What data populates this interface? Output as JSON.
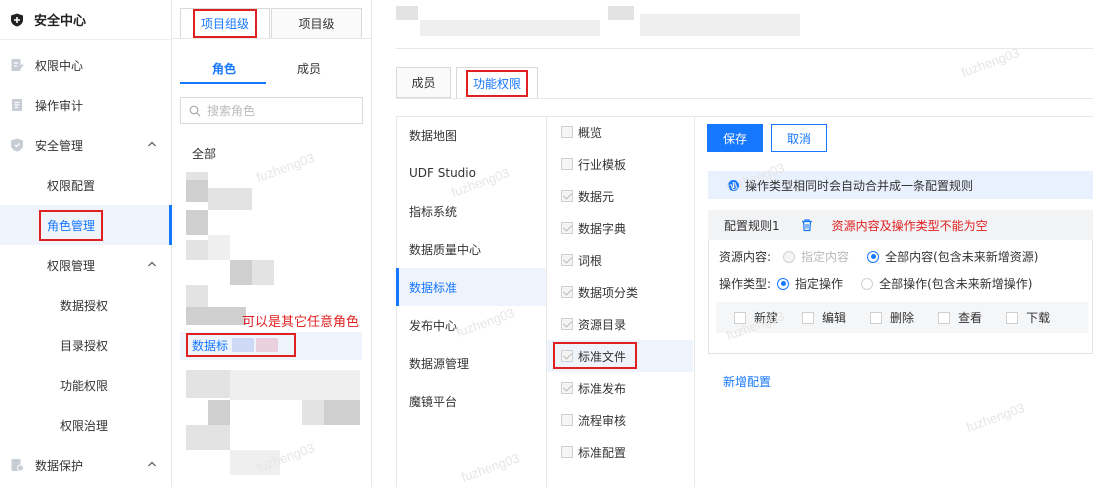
{
  "sidebar": {
    "title": "安全中心",
    "items": [
      {
        "label": "权限中心"
      },
      {
        "label": "操作审计"
      },
      {
        "label": "安全管理"
      },
      {
        "label": "权限配置"
      },
      {
        "label": "角色管理"
      },
      {
        "label": "权限管理"
      },
      {
        "label": "数据授权"
      },
      {
        "label": "目录授权"
      },
      {
        "label": "功能权限"
      },
      {
        "label": "权限治理"
      },
      {
        "label": "数据保护"
      }
    ]
  },
  "roles": {
    "top_tabs": [
      "项目组级",
      "项目级"
    ],
    "sub_tabs": [
      "角色",
      "成员"
    ],
    "search_placeholder": "搜索角色",
    "all_label": "全部",
    "selected_role": "数据标",
    "annotation": "可以是其它任意角色"
  },
  "detail": {
    "tabs": [
      "成员",
      "功能权限"
    ],
    "categories": [
      "数据地图",
      "UDF Studio",
      "指标系统",
      "数据质量中心",
      "数据标准",
      "发布中心",
      "数据源管理",
      "魔镜平台"
    ],
    "permissions": [
      {
        "label": "概览",
        "checked": false
      },
      {
        "label": "行业模板",
        "checked": false
      },
      {
        "label": "数据元",
        "checked": true
      },
      {
        "label": "数据字典",
        "checked": true
      },
      {
        "label": "词根",
        "checked": true
      },
      {
        "label": "数据项分类",
        "checked": true
      },
      {
        "label": "资源目录",
        "checked": true
      },
      {
        "label": "标准文件",
        "checked": true
      },
      {
        "label": "标准发布",
        "checked": true
      },
      {
        "label": "流程审核",
        "checked": false
      },
      {
        "label": "标准配置",
        "checked": false
      }
    ],
    "save_label": "保存",
    "cancel_label": "取消",
    "info_text": "操作类型相同时会自动合并成一条配置规则",
    "rule_title": "配置规则1",
    "rule_error": "资源内容及操作类型不能为空",
    "resource_label": "资源内容:",
    "resource_opt1": "指定内容",
    "resource_opt2": "全部内容(包含未来新增资源)",
    "op_label": "操作类型:",
    "op_opt1": "指定操作",
    "op_opt2": "全部操作(包含未来新增操作)",
    "ops": [
      "新建",
      "编辑",
      "删除",
      "查看",
      "下载"
    ],
    "add_rule": "新增配置"
  },
  "watermark": "fuzheng03",
  "colors": {
    "accent": "#1677ff",
    "annotation": "#e02020"
  }
}
